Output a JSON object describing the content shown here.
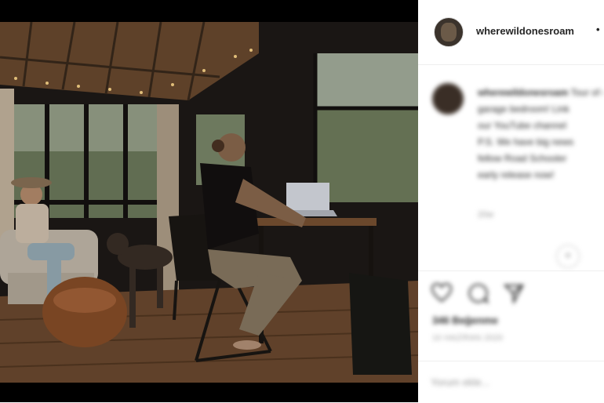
{
  "post": {
    "username": "wherewildonesroam",
    "more_glyph": "•",
    "photo_alt_icon": "photo-scene-icon"
  },
  "caption": {
    "user": "wherewildonesroam",
    "lines": [
      "Tour of our renovated",
      "garage bedroom! Link",
      "our YouTube channel",
      "P.S. We have big news",
      "fellow Road Schooler",
      "early release now!"
    ],
    "time": "20w"
  },
  "actions": {
    "like_icon": "heart-icon",
    "comment_icon": "comment-icon",
    "share_icon": "share-icon",
    "likes_text": "346 Beğenme",
    "date_text": "10 HAZİRAN 2020"
  },
  "comment": {
    "placeholder": "Yorum ekle..."
  },
  "colors": {
    "text": "#262626",
    "muted": "#999999",
    "divider": "#efefef"
  }
}
